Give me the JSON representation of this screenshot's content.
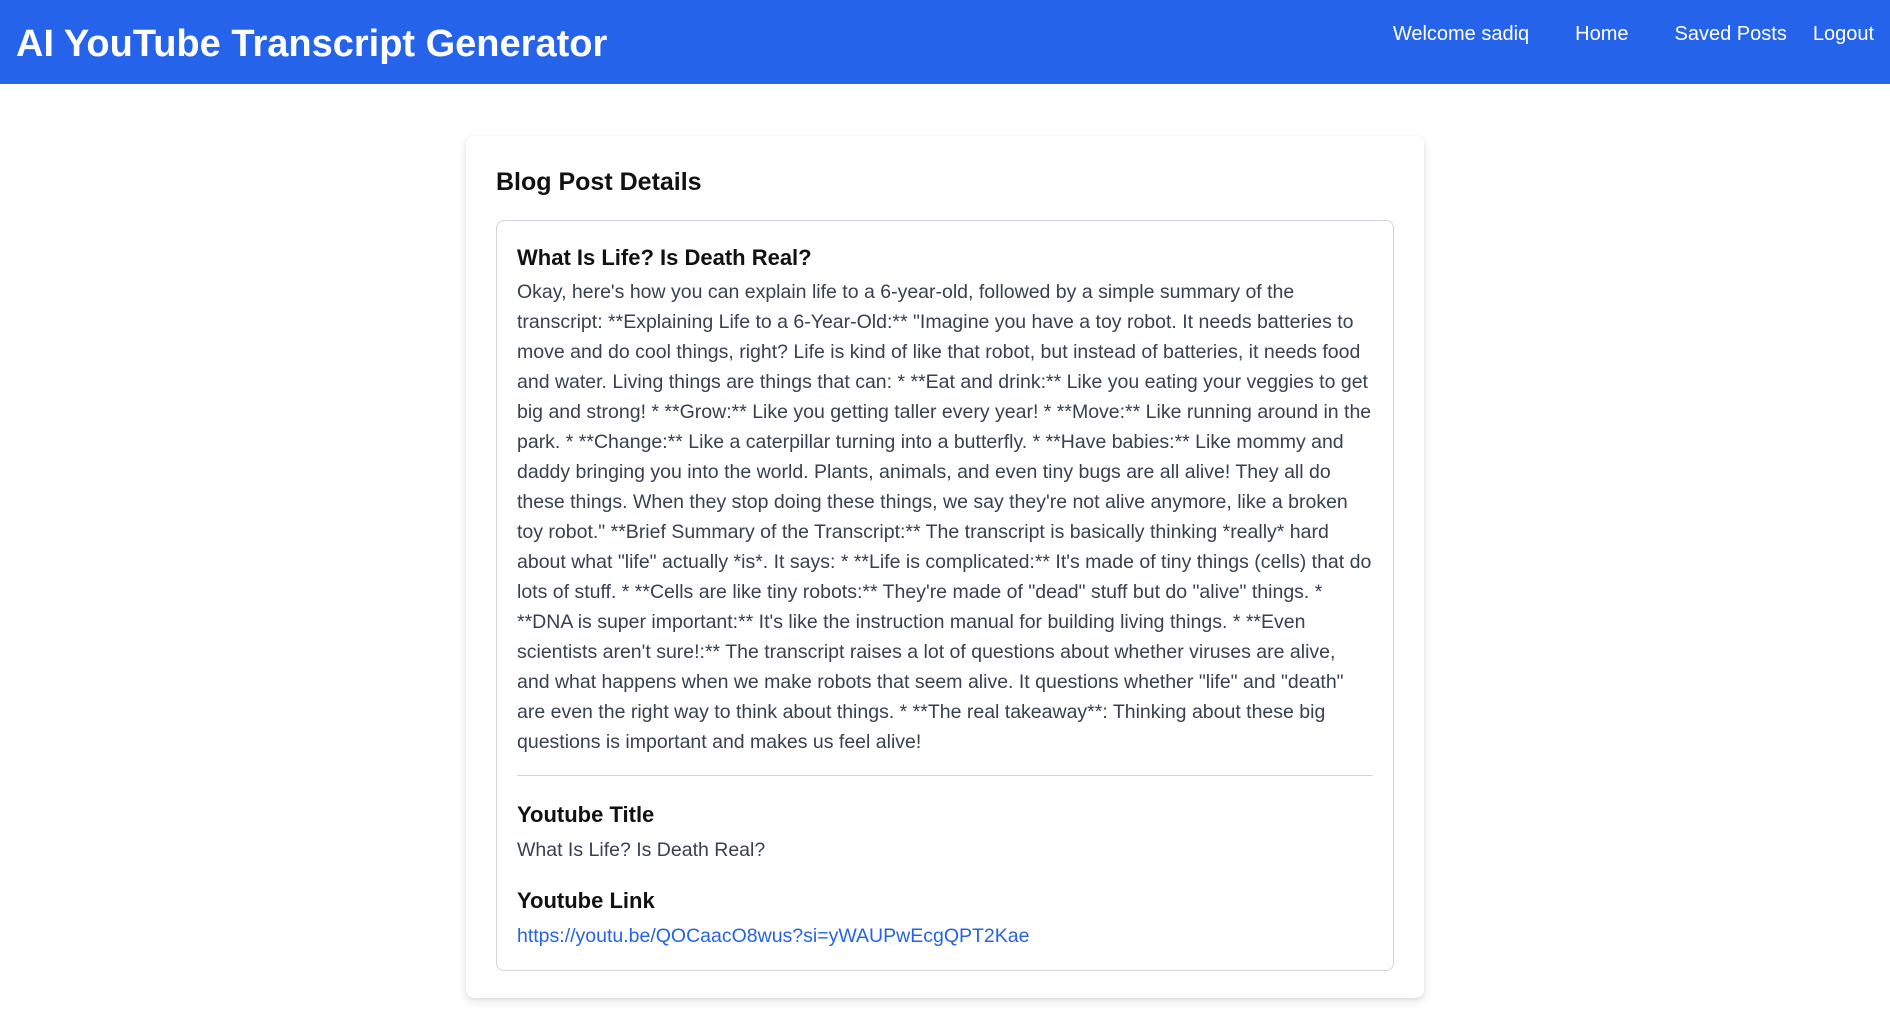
{
  "header": {
    "brand": "AI YouTube Transcript Generator",
    "nav": {
      "welcome": "Welcome sadiq",
      "home": "Home",
      "saved_posts": "Saved Posts",
      "logout": "Logout"
    }
  },
  "main": {
    "heading": "Blog Post Details",
    "post": {
      "title": "What Is Life? Is Death Real?",
      "body": "Okay, here's how you can explain life to a 6-year-old, followed by a simple summary of the transcript: **Explaining Life to a 6-Year-Old:** \"Imagine you have a toy robot. It needs batteries to move and do cool things, right? Life is kind of like that robot, but instead of batteries, it needs food and water. Living things are things that can: * **Eat and drink:** Like you eating your veggies to get big and strong! * **Grow:** Like you getting taller every year! * **Move:** Like running around in the park. * **Change:** Like a caterpillar turning into a butterfly. * **Have babies:** Like mommy and daddy bringing you into the world. Plants, animals, and even tiny bugs are all alive! They all do these things. When they stop doing these things, we say they're not alive anymore, like a broken toy robot.\" **Brief Summary of the Transcript:** The transcript is basically thinking *really* hard about what \"life\" actually *is*. It says: * **Life is complicated:** It's made of tiny things (cells) that do lots of stuff. * **Cells are like tiny robots:** They're made of \"dead\" stuff but do \"alive\" things. * **DNA is super important:** It's like the instruction manual for building living things. * **Even scientists aren't sure!:** The transcript raises a lot of questions about whether viruses are alive, and what happens when we make robots that seem alive. It questions whether \"life\" and \"death\" are even the right way to think about things. * **The real takeaway**: Thinking about these big questions is important and makes us feel alive!",
      "youtube_title_label": "Youtube Title",
      "youtube_title": "What Is Life? Is Death Real?",
      "youtube_link_label": "Youtube Link",
      "youtube_link": "https://youtu.be/QOCaacO8wus?si=yWAUPwEcgQPT2Kae"
    }
  }
}
